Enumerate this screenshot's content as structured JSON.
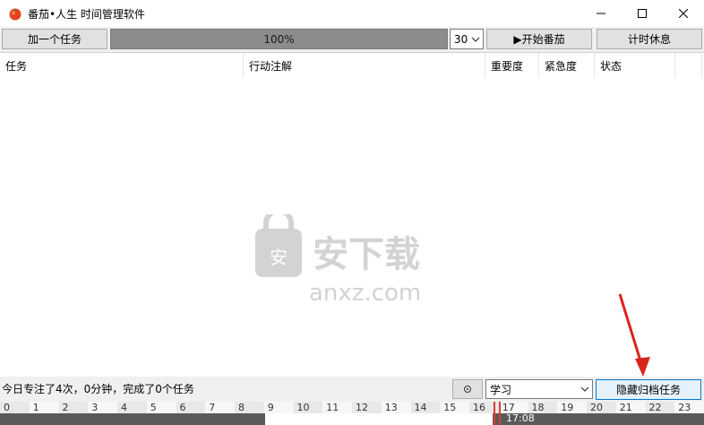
{
  "window": {
    "title": "番茄•人生 时间管理软件"
  },
  "toolbar": {
    "add_task_label": "加一个任务",
    "progress": 1.0,
    "progress_label": "100%",
    "minutes_value": "30",
    "start_label": "▶开始番茄",
    "break_label": "计时休息"
  },
  "table": {
    "columns": [
      "任务",
      "行动注解",
      "重要度",
      "紧急度",
      "状态"
    ],
    "rows": []
  },
  "status": {
    "summary": "今日专注了4次，0分钟，完成了0个任务",
    "category_value": "学习",
    "hide_archived_label": "隐藏归档任务"
  },
  "timeline": {
    "hours": [
      "0",
      "1",
      "2",
      "3",
      "4",
      "5",
      "6",
      "7",
      "8",
      "9",
      "10",
      "11",
      "12",
      "13",
      "14",
      "15",
      "16",
      "17",
      "18",
      "19",
      "20",
      "21",
      "22",
      "23"
    ],
    "current_time": "17:08"
  },
  "watermark": {
    "text_cn": "安下载",
    "text_en": "anxz.com"
  }
}
